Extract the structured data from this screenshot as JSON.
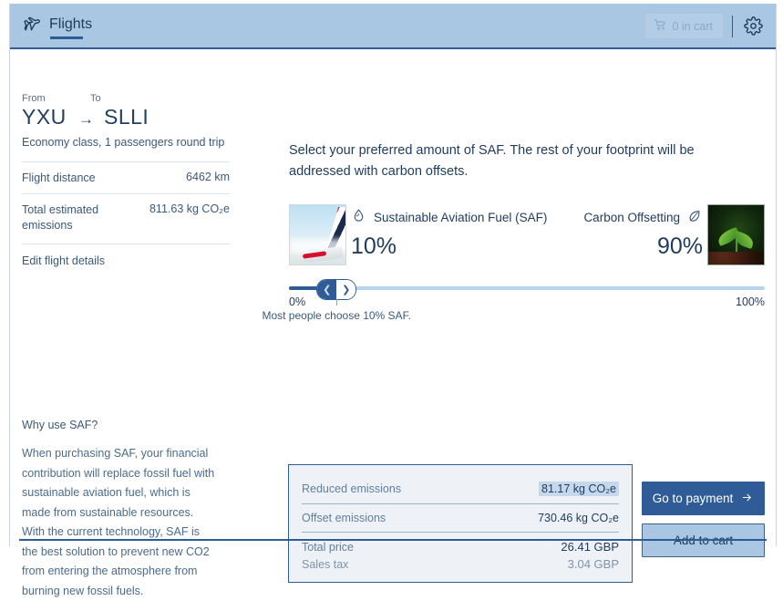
{
  "header": {
    "tab_label": "Flights",
    "plane_icon": "plane-icon",
    "cart_label": "0 in cart",
    "cart_icon": "cart-icon",
    "settings_icon": "gear-icon"
  },
  "flight": {
    "from_label": "From",
    "to_label": "To",
    "from_code": "YXU",
    "to_code": "SLLI",
    "arrow": "→",
    "summary": "Economy class, 1 passengers round trip",
    "distance_label": "Flight distance",
    "distance_value": "6462 km",
    "emissions_label": "Total estimated emissions",
    "emissions_value": "811.63 kg CO₂e",
    "edit_link": "Edit flight details"
  },
  "why": {
    "title": "Why use SAF?",
    "body": "When purchasing SAF, your financial contribution will replace fossil fuel with sustainable aviation fuel, which is made from sustainable resources. With the current technology, SAF is the best solution to prevent new CO2 from entering the atmosphere from burning new fossil fuels."
  },
  "main": {
    "lead": "Select your preferred amount of SAF. The rest of your footprint will be addressed with carbon offsets.",
    "saf": {
      "title": "Sustainable Aviation Fuel (SAF)",
      "percent": "10%",
      "icon": "droplet-icon",
      "image": "airplane-tail-photo"
    },
    "offset": {
      "title": "Carbon Offsetting",
      "percent": "90%",
      "icon": "leaf-icon",
      "image": "green-seedling-photo"
    }
  },
  "slider": {
    "min_label": "0%",
    "max_label": "100%",
    "value": 10,
    "note": "Most people choose 10% SAF.",
    "decrease_icon": "chevron-left-icon",
    "increase_icon": "chevron-right-icon"
  },
  "summary": {
    "reduced_label": "Reduced emissions",
    "reduced_value": "81.17 kg CO₂e",
    "offset_label": "Offset emissions",
    "offset_value": "730.46 kg CO₂e",
    "total_label": "Total price",
    "total_value": "26.41 GBP",
    "tax_label": "Sales tax",
    "tax_value": "3.04 GBP"
  },
  "actions": {
    "primary_label": "Go to payment",
    "primary_icon": "arrow-right-icon",
    "secondary_label": "Add to cart"
  },
  "colors": {
    "header_bg": "#a9c6e3",
    "accent": "#2f5c96",
    "panel_bg": "#eef2f7",
    "highlight": "#c5d8ec"
  }
}
